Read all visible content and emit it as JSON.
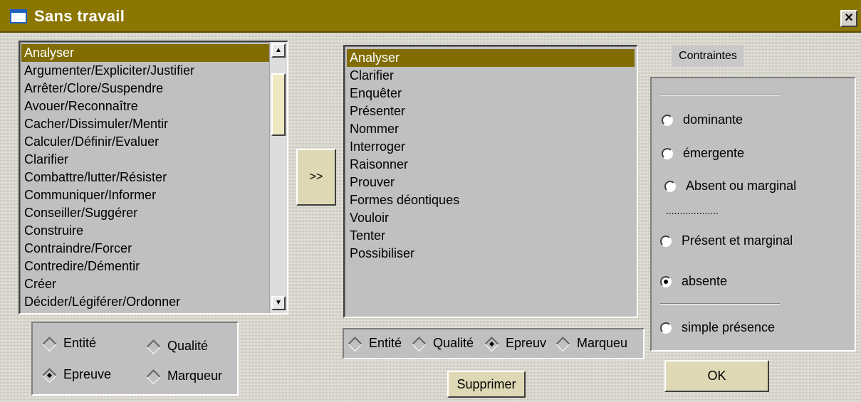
{
  "window": {
    "title": "Sans travail",
    "close_label": "×"
  },
  "left_list": {
    "selected_index": 0,
    "items": [
      "Analyser",
      "Argumenter/Expliciter/Justifier",
      "Arrêter/Clore/Suspendre",
      "Avouer/Reconnaître",
      "Cacher/Dissimuler/Mentir",
      "Calculer/Définir/Evaluer",
      "Clarifier",
      "Combattre/lutter/Résister",
      "Communiquer/Informer",
      "Conseiller/Suggérer",
      "Construire",
      "Contraindre/Forcer",
      "Contredire/Démentir",
      "Créer",
      "Décider/Légiférer/Ordonner"
    ],
    "scroll_up": "▲",
    "scroll_down": "▼"
  },
  "left_type_group": {
    "options": [
      {
        "label": "Entité",
        "checked": false
      },
      {
        "label": "Qualité",
        "checked": false
      },
      {
        "label": "Epreuve",
        "checked": true
      },
      {
        "label": "Marqueur",
        "checked": false
      }
    ]
  },
  "transfer_button": ">>",
  "right_list": {
    "selected_index": 0,
    "items": [
      "Analyser",
      "Clarifier",
      "Enquêter",
      "Présenter",
      "Nommer",
      "Interroger",
      "Raisonner",
      "Prouver",
      "Formes déontiques",
      "Vouloir",
      "Tenter",
      "Possibiliser"
    ]
  },
  "right_type_group": {
    "options": [
      {
        "label": "Entité",
        "checked": false
      },
      {
        "label": "Qualité",
        "checked": false
      },
      {
        "label": "Epreuv",
        "checked": true
      },
      {
        "label": "Marqueu",
        "checked": false
      }
    ]
  },
  "delete_button": "Supprimer",
  "constraints": {
    "title": "Contraintes",
    "dotted_separator": "...................",
    "options": [
      {
        "label": "dominante",
        "checked": false
      },
      {
        "label": "émergente",
        "checked": false
      },
      {
        "label": "Absent ou marginal",
        "checked": false
      },
      {
        "label": "Présent et marginal",
        "checked": false
      },
      {
        "label": "absente",
        "checked": true
      },
      {
        "label": "simple présence",
        "checked": false
      }
    ]
  },
  "ok_button": "OK"
}
